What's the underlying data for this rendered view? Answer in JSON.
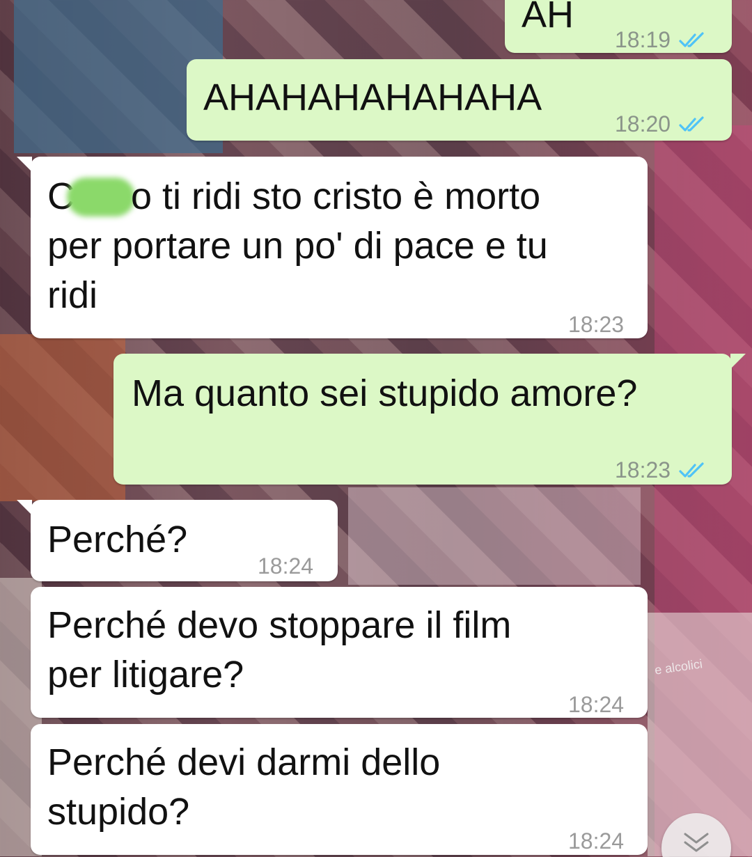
{
  "wallpaper": {
    "caption": "e alcolici"
  },
  "messages": [
    {
      "direction": "outgoing",
      "text": "AH",
      "time": "18:19",
      "status": "read"
    },
    {
      "direction": "outgoing",
      "text": "AHAHAHAHAHAHA",
      "time": "18:20",
      "status": "read"
    },
    {
      "direction": "incoming",
      "text_start": "C",
      "text_rest": "o ti ridi sto cristo è morto\nper portare un po' di pace e tu\nridi",
      "redacted": true,
      "time": "18:23"
    },
    {
      "direction": "outgoing",
      "text": "Ma quanto sei stupido amore?",
      "time": "18:23",
      "status": "read"
    },
    {
      "direction": "incoming",
      "text": "Perché?",
      "time": "18:24"
    },
    {
      "direction": "incoming",
      "text": "Perché devo stoppare il film\nper litigare?",
      "time": "18:24"
    },
    {
      "direction": "incoming",
      "text": "Perché devi darmi dello\nstupido?",
      "time": "18:24"
    }
  ],
  "colors": {
    "outgoing_bubble": "#dcf8c6",
    "incoming_bubble": "#ffffff",
    "read_ticks": "#4fc3f7",
    "redaction": "#8bd96a"
  },
  "icons": {
    "read_status": "double-check-icon",
    "scroll_down": "chevron-double-down-icon"
  }
}
